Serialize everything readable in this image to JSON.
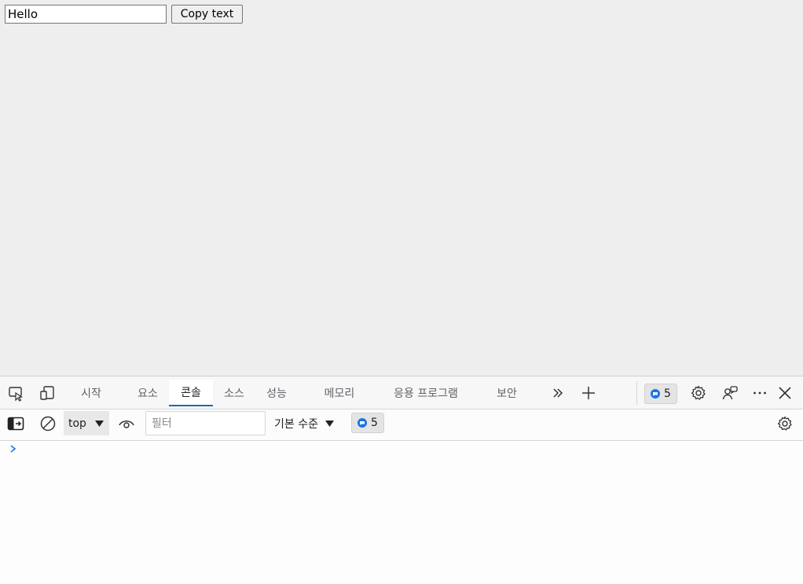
{
  "page": {
    "input_value": "Hello",
    "button_label": "Copy text"
  },
  "devtools": {
    "tabs": [
      {
        "label": "시작",
        "active": false
      },
      {
        "label": "요소",
        "active": false
      },
      {
        "label": "콘솔",
        "active": true
      },
      {
        "label": "소스",
        "active": false
      },
      {
        "label": "성능",
        "active": false
      },
      {
        "label": "메모리",
        "active": false
      },
      {
        "label": "응용 프로그램",
        "active": false
      },
      {
        "label": "보안",
        "active": false
      }
    ],
    "issues_count": "5",
    "icons": {
      "inspect": "inspect-element-icon",
      "device": "device-emulation-icon",
      "more_tabs": "chevron-double-right-icon",
      "add_tab": "plus-icon",
      "settings": "gear-icon",
      "feedback": "feedback-icon",
      "more": "ellipsis-icon",
      "close": "close-icon"
    },
    "accent_color": "#0f6cbd"
  },
  "console_toolbar": {
    "context": "top",
    "filter_placeholder": "필터",
    "level": "기본 수준",
    "issues_count": "5"
  }
}
